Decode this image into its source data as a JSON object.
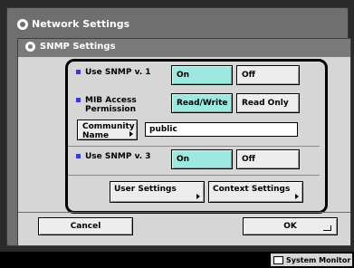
{
  "window_title": "Network Settings",
  "panel_title": "SNMP Settings",
  "snmp_v1": {
    "label": "Use SNMP v. 1",
    "on": "On",
    "off": "Off",
    "selected": "on"
  },
  "mib_access": {
    "label_line1": "MIB Access",
    "label_line2": "Permission",
    "read_write": "Read/Write",
    "read_only": "Read Only",
    "selected": "read_write"
  },
  "community": {
    "button_line1": "Community",
    "button_line2": "Name",
    "value": "public"
  },
  "snmp_v3": {
    "label": "Use SNMP v. 3",
    "on": "On",
    "off": "Off",
    "selected": "on"
  },
  "user_settings": "User Settings",
  "context_settings": "Context Settings",
  "cancel": "Cancel",
  "ok": "OK",
  "system_monitor": "System Monitor"
}
